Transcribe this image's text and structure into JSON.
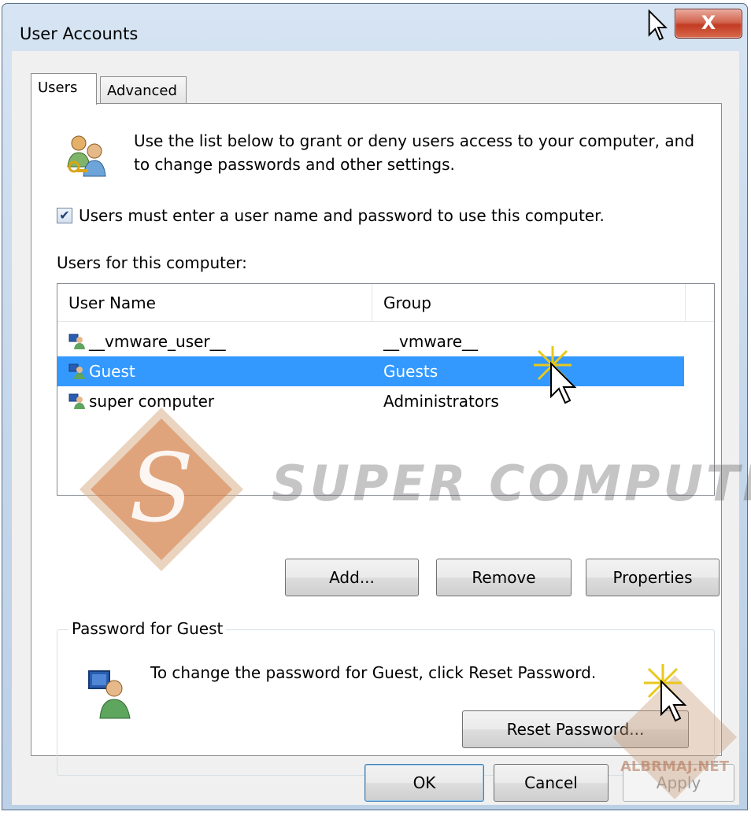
{
  "window": {
    "title": "User Accounts",
    "close_glyph": "X"
  },
  "tabs": [
    {
      "label": "Users",
      "selected": true
    },
    {
      "label": "Advanced",
      "selected": false
    }
  ],
  "intro": {
    "icon": "users-keys-icon",
    "text": "Use the list below to grant or deny users access to your computer, and to change passwords and other settings."
  },
  "require_login": {
    "checked": true,
    "label": "Users must enter a user name and password to use this computer."
  },
  "users_list": {
    "label": "Users for this computer:",
    "columns": [
      "User Name",
      "Group"
    ],
    "rows": [
      {
        "name": "__vmware_user__",
        "group": "__vmware__",
        "selected": false
      },
      {
        "name": "Guest",
        "group": "Guests",
        "selected": true
      },
      {
        "name": "super computer",
        "group": "Administrators",
        "selected": false
      }
    ]
  },
  "list_buttons": {
    "add": "Add...",
    "remove": "Remove",
    "properties": "Properties"
  },
  "password_group": {
    "legend": "Password for Guest",
    "text": "To change the password for Guest, click Reset Password.",
    "reset_button": "Reset Password..."
  },
  "dialog_buttons": {
    "ok": "OK",
    "cancel": "Cancel",
    "apply": "Apply"
  },
  "watermarks": {
    "logo_letter": "S",
    "brand_text": "SUPER COMPUTER",
    "site_text": "ALBRMAJ.NET"
  },
  "colors": {
    "selection": "#3399ff",
    "close_button": "#c23b22",
    "watermark_orange": "#e06a1a"
  }
}
